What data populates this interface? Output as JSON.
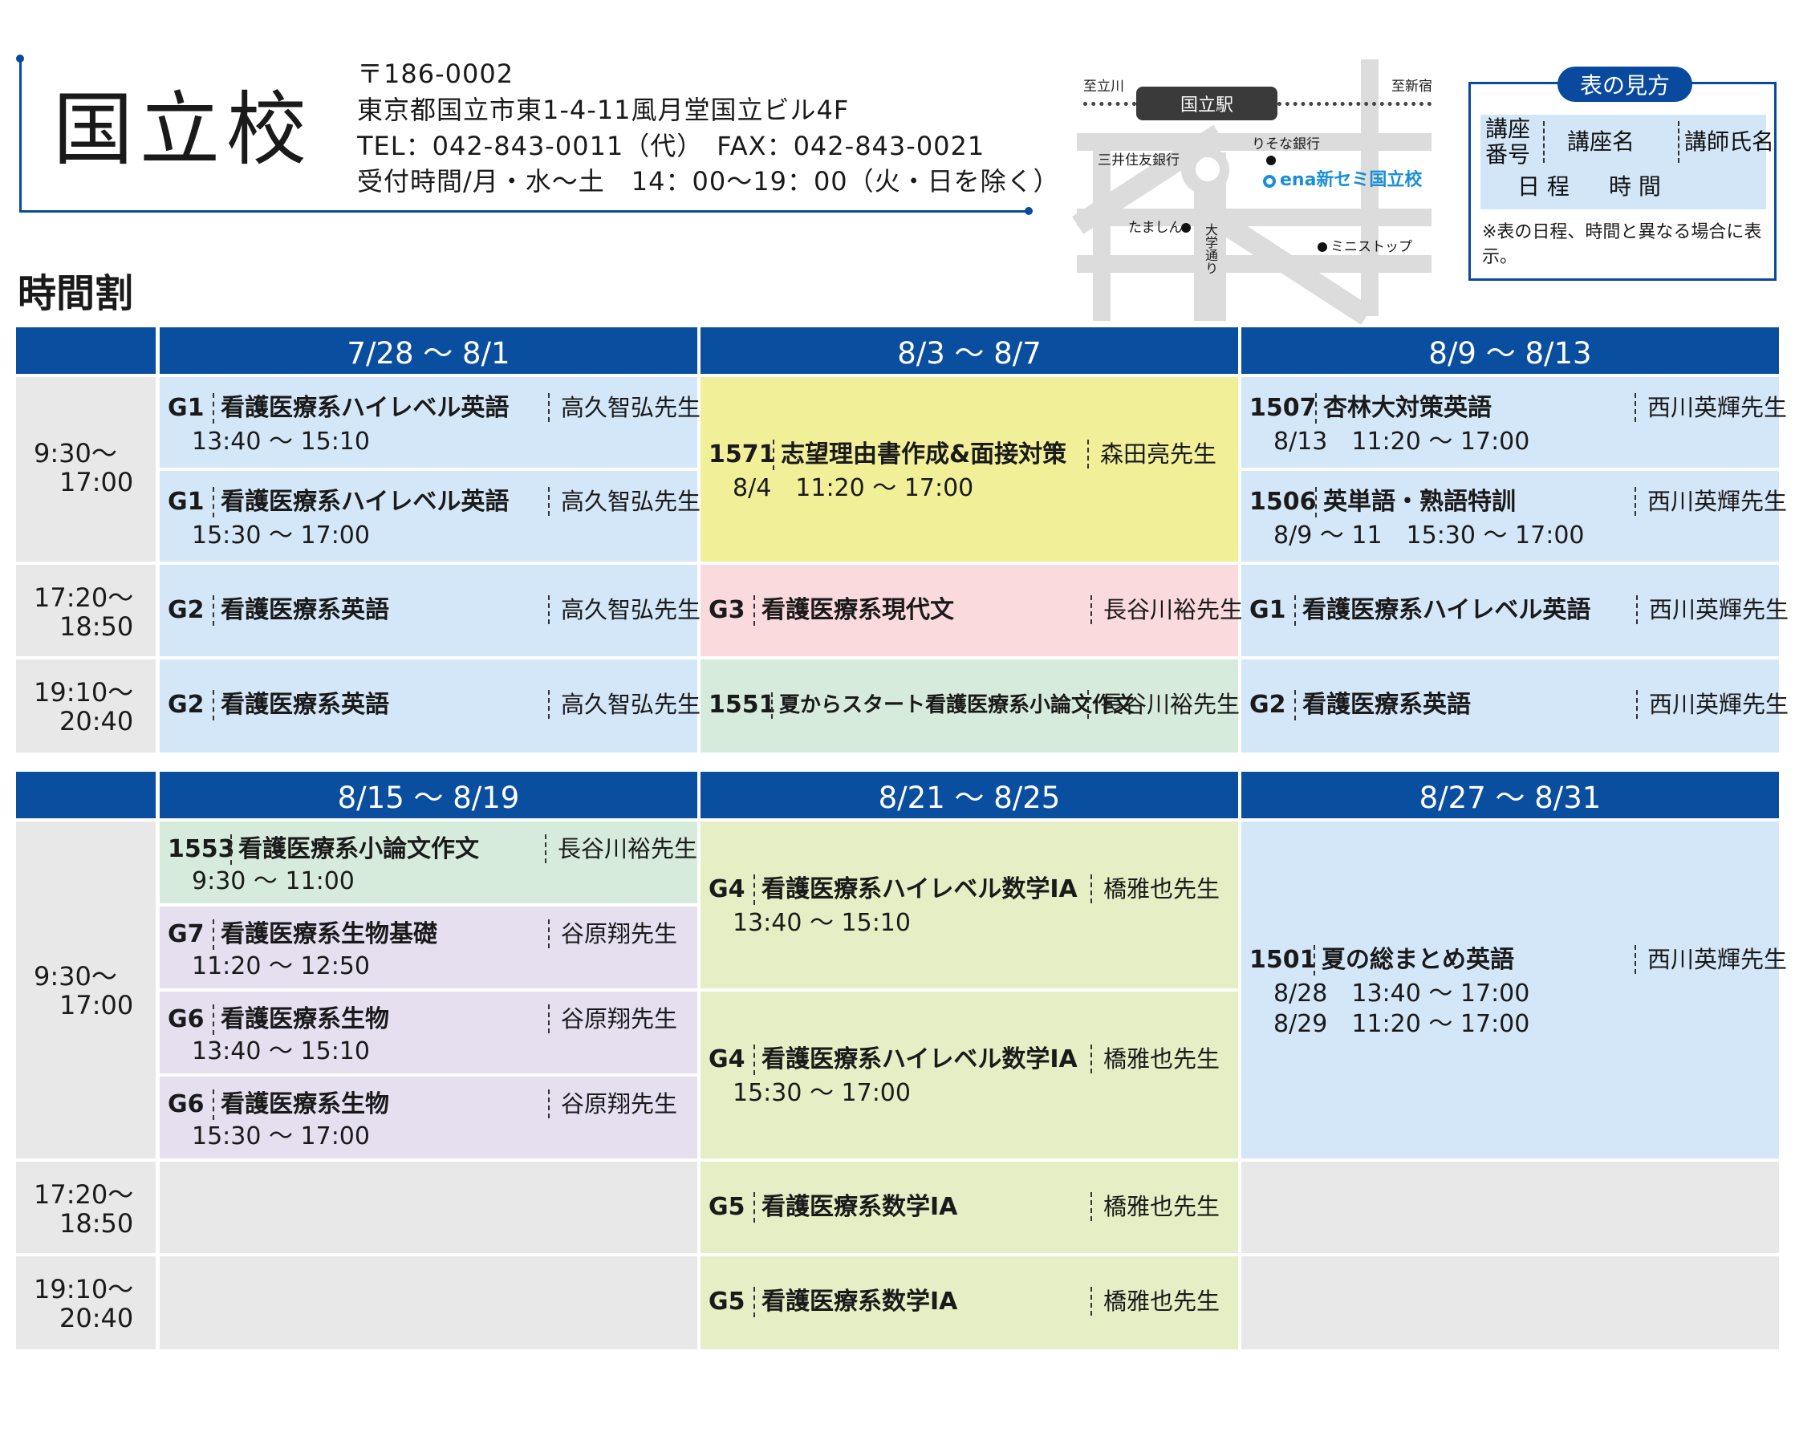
{
  "header": {
    "school_name": "国立校",
    "postal": "〒186-0002",
    "address": "東京都国立市東1-4-11風月堂国立ビル4F",
    "phone_fax": "TEL：042-843-0011（代）　FAX：042-843-0021",
    "hours": "受付時間/月・水～土　14：00～19：00（火・日を除く）"
  },
  "map": {
    "station": "国立駅",
    "to_left": "至立川",
    "to_right": "至新宿",
    "bank1": "三井住友銀行",
    "bank2": "りそな銀行",
    "school": "ena新セミ国立校",
    "shop1": "たましん",
    "street": "大学通り",
    "shop2": "ミニストップ",
    "school_color": "#1a8fd8"
  },
  "legend": {
    "title": "表の見方",
    "code": "講座\n番号",
    "course": "講座名",
    "teacher": "講師氏名",
    "schedule": "日 程",
    "time": "時 間",
    "note": "※表の日程、時間と異なる場合に表示。"
  },
  "section_title": "時間割",
  "colors": {
    "header_blue": "#0a4ea0",
    "blue": "#d4e7f8",
    "yellow": "#f1f099",
    "pink": "#fadadd",
    "green": "#d6ebdb",
    "purple": "#e5dff0",
    "lime": "#e5eec4",
    "gray": "#e8e8e8"
  },
  "times": {
    "morning": [
      "9:30～",
      "17:00"
    ],
    "evening1": [
      "17:20～",
      "18:50"
    ],
    "evening2": [
      "19:10～",
      "20:40"
    ]
  },
  "table1": {
    "dates": [
      "7/28 ～ 8/1",
      "8/3 ～ 8/7",
      "8/9 ～ 8/13"
    ],
    "courses": [
      {
        "code": "G1",
        "name": "看護医療系ハイレベル英語",
        "teacher": "高久智弘先生",
        "sched": [
          "13:40 ～ 15:10"
        ]
      },
      {
        "code": "G1",
        "name": "看護医療系ハイレベル英語",
        "teacher": "高久智弘先生",
        "sched": [
          "15:30 ～ 17:00"
        ]
      },
      {
        "code": "1571",
        "name": "志望理由書作成&面接対策",
        "teacher": "森田亮先生",
        "sched": [
          "8/4　11:20 ～ 17:00"
        ]
      },
      {
        "code": "1507",
        "name": "杏林大対策英語",
        "teacher": "西川英輝先生",
        "sched": [
          "8/13　11:20 ～ 17:00"
        ]
      },
      {
        "code": "1506",
        "name": "英単語・熟語特訓",
        "teacher": "西川英輝先生",
        "sched": [
          "8/9 ～ 11　15:30 ～ 17:00"
        ]
      },
      {
        "code": "G2",
        "name": "看護医療系英語",
        "teacher": "高久智弘先生",
        "sched": []
      },
      {
        "code": "G3",
        "name": "看護医療系現代文",
        "teacher": "長谷川裕先生",
        "sched": []
      },
      {
        "code": "G1",
        "name": "看護医療系ハイレベル英語",
        "teacher": "西川英輝先生",
        "sched": []
      },
      {
        "code": "G2",
        "name": "看護医療系英語",
        "teacher": "高久智弘先生",
        "sched": []
      },
      {
        "code": "1551",
        "name": "夏からスタート看護医療系小論文作文",
        "teacher": "長谷川裕先生",
        "sched": []
      },
      {
        "code": "G2",
        "name": "看護医療系英語",
        "teacher": "西川英輝先生",
        "sched": []
      }
    ]
  },
  "table2": {
    "dates": [
      "8/15 ～ 8/19",
      "8/21 ～ 8/25",
      "8/27 ～ 8/31"
    ],
    "courses": [
      {
        "code": "1553",
        "name": "看護医療系小論文作文",
        "teacher": "長谷川裕先生",
        "sched": [
          "9:30 ～ 11:00"
        ]
      },
      {
        "code": "G7",
        "name": "看護医療系生物基礎",
        "teacher": "谷原翔先生",
        "sched": [
          "11:20 ～ 12:50"
        ]
      },
      {
        "code": "G6",
        "name": "看護医療系生物",
        "teacher": "谷原翔先生",
        "sched": [
          "13:40 ～ 15:10"
        ]
      },
      {
        "code": "G6",
        "name": "看護医療系生物",
        "teacher": "谷原翔先生",
        "sched": [
          "15:30 ～ 17:00"
        ]
      },
      {
        "code": "G4",
        "name": "看護医療系ハイレベル数学ⅠA",
        "teacher": "橋雅也先生",
        "sched": [
          "13:40 ～ 15:10"
        ]
      },
      {
        "code": "G4",
        "name": "看護医療系ハイレベル数学ⅠA",
        "teacher": "橋雅也先生",
        "sched": [
          "15:30 ～ 17:00"
        ]
      },
      {
        "code": "1501",
        "name": "夏の総まとめ英語",
        "teacher": "西川英輝先生",
        "sched": [
          "8/28　13:40 ～ 17:00",
          "8/29　11:20 ～ 17:00"
        ]
      },
      {
        "code": "G5",
        "name": "看護医療系数学ⅠA",
        "teacher": "橋雅也先生",
        "sched": []
      },
      {
        "code": "G5",
        "name": "看護医療系数学ⅠA",
        "teacher": "橋雅也先生",
        "sched": []
      }
    ]
  }
}
